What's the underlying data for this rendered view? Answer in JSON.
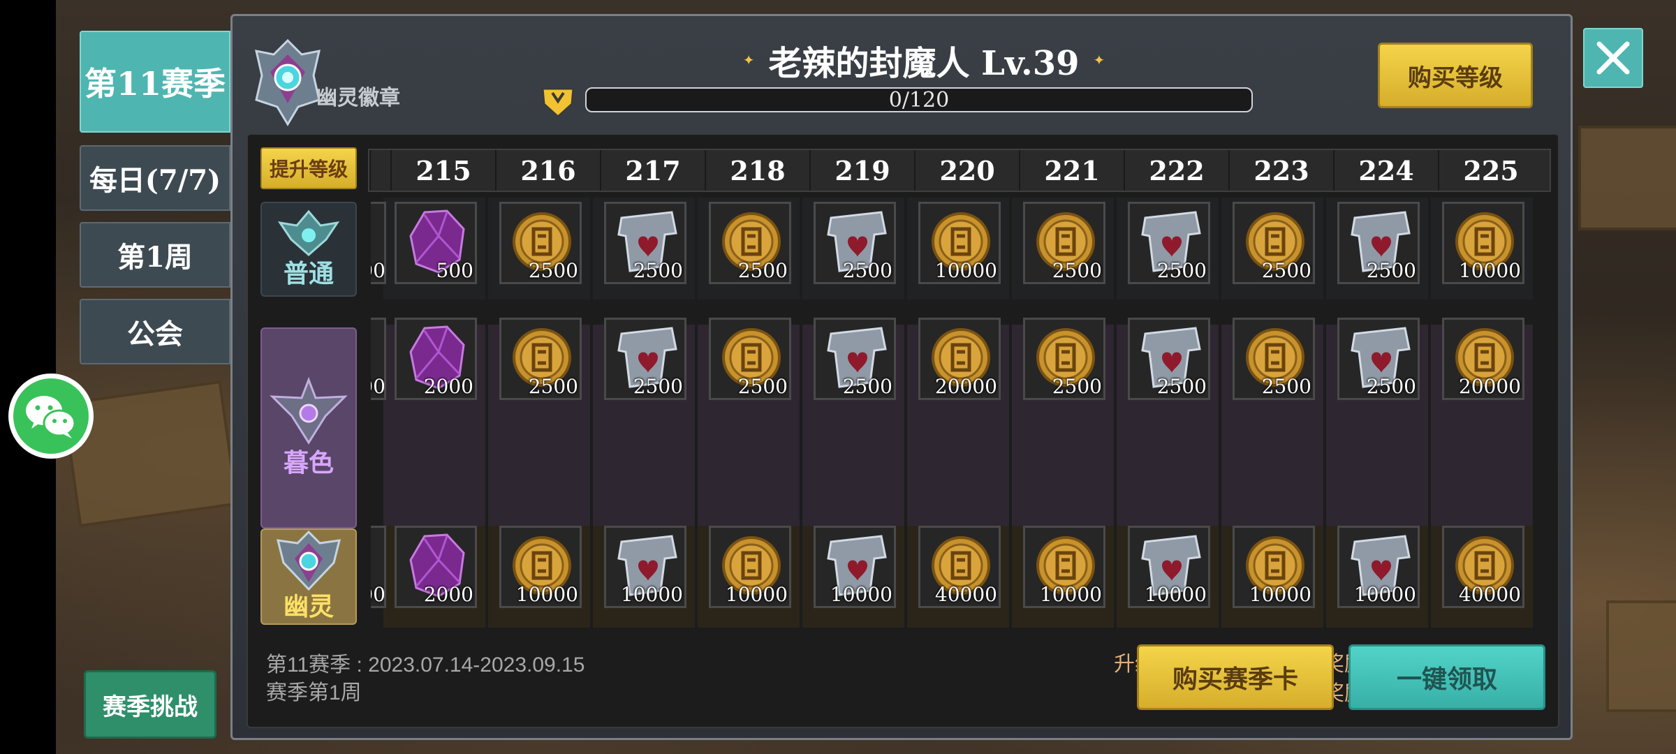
{
  "left_tabs": [
    {
      "label": "第11赛季",
      "active": true
    },
    {
      "label": "每日(7/7)",
      "active": false
    },
    {
      "label": "第1周",
      "active": false
    },
    {
      "label": "公会",
      "active": false
    }
  ],
  "season_challenge_label": "赛季挑战",
  "header": {
    "badge_label": "幽灵徽章",
    "title": "老辣的封魔人 Lv.39",
    "xp_text": "0/120",
    "buy_level_label": "购买等级"
  },
  "raise_level_label": "提升等级",
  "levels": [
    "215",
    "216",
    "217",
    "218",
    "219",
    "220",
    "221",
    "222",
    "223",
    "224",
    "225"
  ],
  "tiers": [
    {
      "name": "普通",
      "partial_qty": "00",
      "rewards": [
        {
          "icon": "purple-crystal-icon",
          "qty": "500"
        },
        {
          "icon": "gold-coin-icon",
          "qty": "2500"
        },
        {
          "icon": "silver-shield-icon",
          "qty": "2500"
        },
        {
          "icon": "gold-coin-icon",
          "qty": "2500"
        },
        {
          "icon": "silver-shield-icon",
          "qty": "2500"
        },
        {
          "icon": "gold-coin-icon",
          "qty": "10000"
        },
        {
          "icon": "gold-coin-icon",
          "qty": "2500"
        },
        {
          "icon": "silver-shield-icon",
          "qty": "2500"
        },
        {
          "icon": "gold-coin-icon",
          "qty": "2500"
        },
        {
          "icon": "silver-shield-icon",
          "qty": "2500"
        },
        {
          "icon": "gold-coin-icon",
          "qty": "10000"
        }
      ]
    },
    {
      "name": "暮色",
      "partial_qty": "00",
      "rewards": [
        {
          "icon": "purple-crystal-icon",
          "qty": "2000"
        },
        {
          "icon": "gold-coin-icon",
          "qty": "2500"
        },
        {
          "icon": "silver-shield-icon",
          "qty": "2500"
        },
        {
          "icon": "gold-coin-icon",
          "qty": "2500"
        },
        {
          "icon": "silver-shield-icon",
          "qty": "2500"
        },
        {
          "icon": "gold-coin-icon",
          "qty": "20000"
        },
        {
          "icon": "gold-coin-icon",
          "qty": "2500"
        },
        {
          "icon": "silver-shield-icon",
          "qty": "2500"
        },
        {
          "icon": "gold-coin-icon",
          "qty": "2500"
        },
        {
          "icon": "silver-shield-icon",
          "qty": "2500"
        },
        {
          "icon": "gold-coin-icon",
          "qty": "20000"
        }
      ]
    },
    {
      "name": "幽灵",
      "partial_qty": "00",
      "rewards": [
        {
          "icon": "purple-crystal-icon",
          "qty": "2000"
        },
        {
          "icon": "gold-coin-icon",
          "qty": "10000"
        },
        {
          "icon": "silver-shield-icon",
          "qty": "10000"
        },
        {
          "icon": "gold-coin-icon",
          "qty": "10000"
        },
        {
          "icon": "silver-shield-icon",
          "qty": "10000"
        },
        {
          "icon": "gold-coin-icon",
          "qty": "40000"
        },
        {
          "icon": "gold-coin-icon",
          "qty": "10000"
        },
        {
          "icon": "silver-shield-icon",
          "qty": "10000"
        },
        {
          "icon": "gold-coin-icon",
          "qty": "10000"
        },
        {
          "icon": "silver-shield-icon",
          "qty": "10000"
        },
        {
          "icon": "gold-coin-icon",
          "qty": "40000"
        }
      ]
    }
  ],
  "footer": {
    "season_dates": "第11赛季 : 2023.07.14-2023.09.15",
    "season_week": "赛季第1周",
    "promo_line1": "升级徽章可以领取专属奖励",
    "promo_line2": "并获取额外特殊奖励",
    "buy_season_card_label": "购买赛季卡",
    "claim_all_label": "一键领取"
  }
}
